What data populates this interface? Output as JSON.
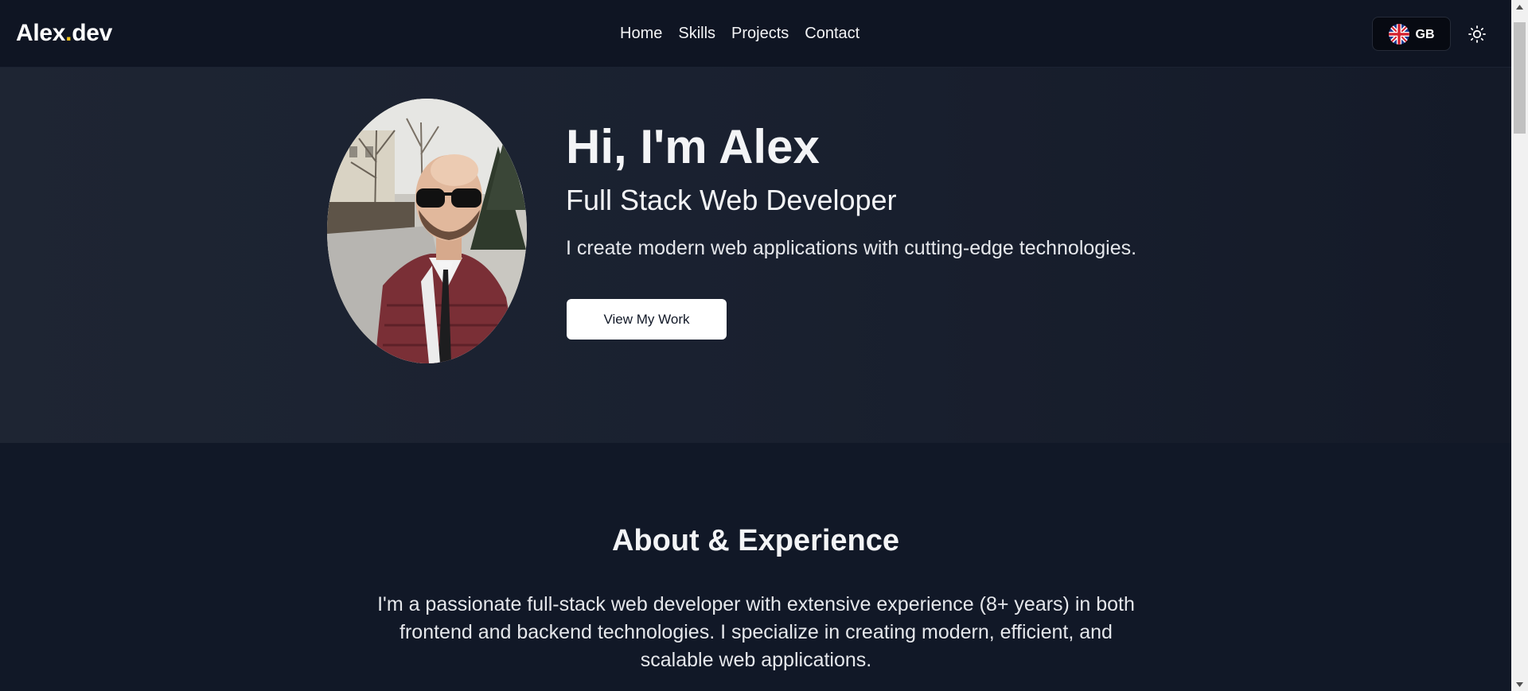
{
  "header": {
    "logo_main": "Alex",
    "logo_dot": ".",
    "logo_suffix": "dev",
    "nav": [
      {
        "label": "Home"
      },
      {
        "label": "Skills"
      },
      {
        "label": "Projects"
      },
      {
        "label": "Contact"
      }
    ],
    "language": {
      "code": "GB",
      "flag": "uk-flag-icon"
    },
    "theme_icon": "sun-icon"
  },
  "hero": {
    "title": "Hi, I'm Alex",
    "subtitle": "Full Stack Web Developer",
    "description": "I create modern web applications with cutting-edge technologies.",
    "button_label": "View My Work"
  },
  "about": {
    "title": "About & Experience",
    "text": "I'm a passionate full-stack web developer with extensive experience (8+ years) in both frontend and backend technologies. I specialize in creating modern, efficient, and scalable web applications."
  },
  "colors": {
    "background": "#111827",
    "header": "#0f1523",
    "accent_dot": "#f5c518",
    "button_bg": "#ffffff",
    "text": "#f3f4f6"
  }
}
